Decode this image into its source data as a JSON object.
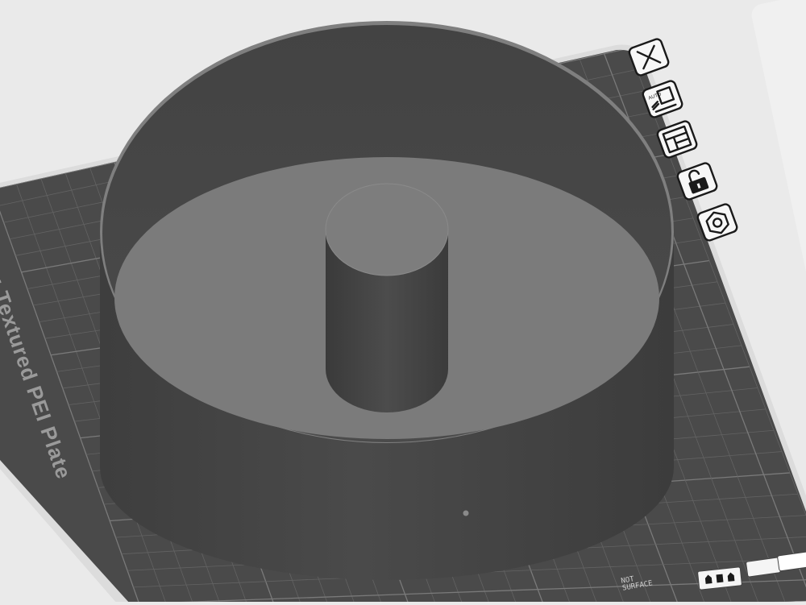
{
  "window": {
    "app": "Bambu Studio 3D viewport"
  },
  "bed": {
    "plate_label": "Bambu Textured PEI Plate",
    "surface_color": "#4a4a4a",
    "grid_color": "#6e6e6e",
    "border_color": "#d9d9d9"
  },
  "model": {
    "wall_color": "#454545",
    "floor_color": "#7b7b7b",
    "post_color": "#474747"
  },
  "plate_toolbar": {
    "items": [
      {
        "id": "delete",
        "icon": "close-icon"
      },
      {
        "id": "auto-orient",
        "icon": "auto-orient-icon",
        "badge": "AUTO"
      },
      {
        "id": "arrange",
        "icon": "arrange-icon"
      },
      {
        "id": "lock",
        "icon": "unlock-icon"
      },
      {
        "id": "settings",
        "icon": "hex-settings-icon"
      }
    ]
  },
  "bottom": {
    "hint_line1": "NOT",
    "hint_line2": "SURFACE"
  }
}
